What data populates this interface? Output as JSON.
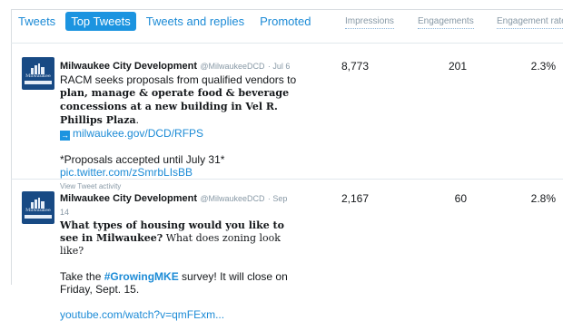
{
  "tabs": [
    {
      "label": "Tweets",
      "active": false
    },
    {
      "label": "Top Tweets",
      "active": true
    },
    {
      "label": "Tweets and replies",
      "active": false
    },
    {
      "label": "Promoted",
      "active": false
    }
  ],
  "columns": {
    "impressions": "Impressions",
    "engagements": "Engagements",
    "engagement_rate": "Engagement rate"
  },
  "colors": {
    "accent": "#1c94e0",
    "link": "#1c8bd6",
    "muted": "#8899a6",
    "avatar_bg": "#184a84"
  },
  "avatar": {
    "icon": "city-of-milwaukee-logo",
    "logo_line1": "Milwaukee",
    "logo_line2": "CITY DEVELOPMENT"
  },
  "tweets": [
    {
      "author": "Milwaukee City Development",
      "handle": "@MilwaukeeDCD",
      "date": "· Jul 6",
      "text_before": "RACM seeks proposals from qualified vendors to ",
      "text_bold": "plan, manage & operate food & beverage concessions at a new building in Vel R. Phillips Plaza",
      "text_after": ".",
      "link": "milwaukee.gov/DCD/RFPS",
      "note": "*Proposals accepted until July 31*",
      "pic_link": "pic.twitter.com/zSmrbLIsBB",
      "activity": "View Tweet activity",
      "impressions": "8,773",
      "engagements": "201",
      "rate": "2.3%"
    },
    {
      "author": "Milwaukee City Development",
      "handle": "@MilwaukeeDCD",
      "date": "· Sep 14",
      "text_bold": "What types of housing would you like to see in Milwaukee?",
      "text_after": " What does zoning look like?",
      "cta_before": "Take the ",
      "hashtag": "#GrowingMKE",
      "cta_after": " survey! It will close on Friday, Sept. 15.",
      "link": "youtube.com/watch?v=qmFExm...",
      "impressions": "2,167",
      "engagements": "60",
      "rate": "2.8%"
    }
  ]
}
